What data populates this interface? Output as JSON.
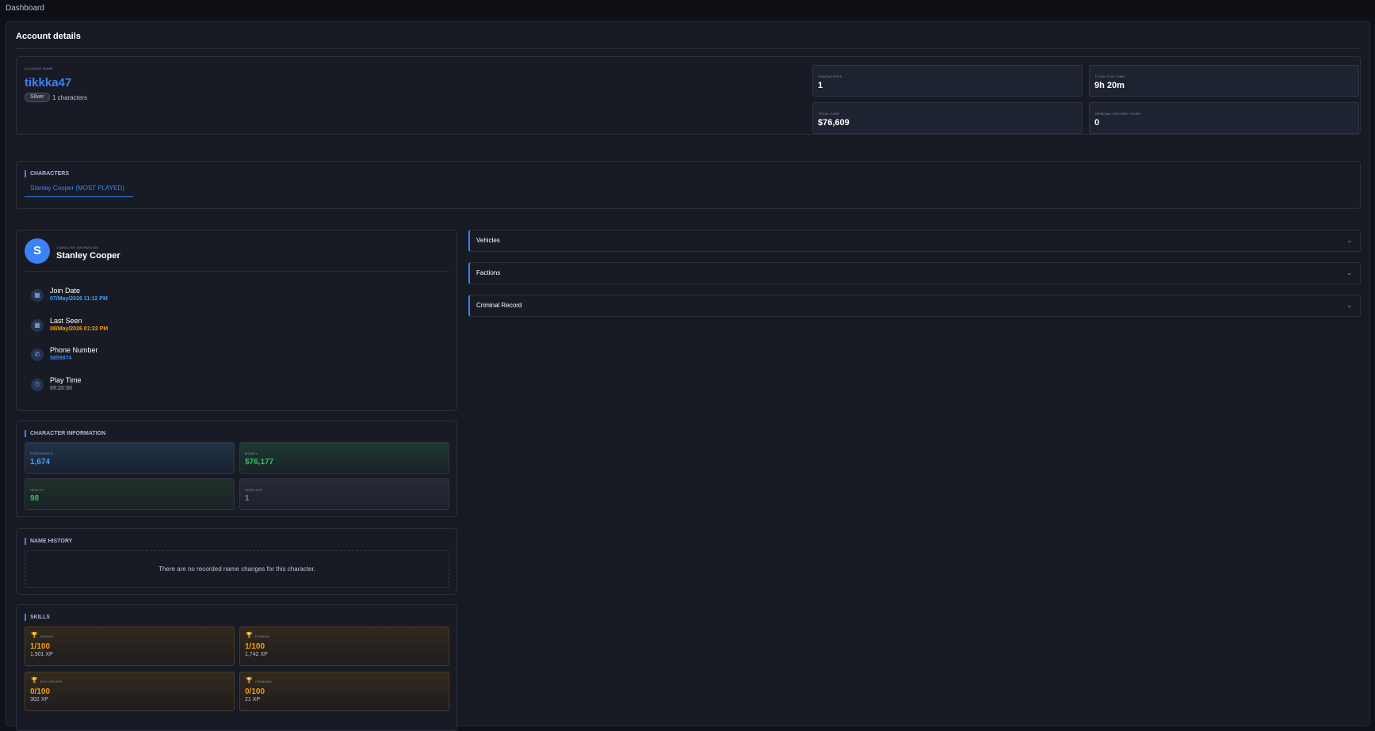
{
  "topbar": {
    "label": "Dashboard"
  },
  "panel": {
    "title": "Account details"
  },
  "account": {
    "name_label": "ACCOUNT NAME",
    "name": "tikkka47",
    "tier": "Silver",
    "characters_text": "1 characters",
    "stats": [
      {
        "label": "CHARACTERS",
        "value": "1"
      },
      {
        "label": "TOTAL PLAY TIME",
        "value": "9h 20m"
      },
      {
        "label": "TOTAL CASH",
        "value": "$76,609"
      },
      {
        "label": "CRIMINAL RECORD COUNT",
        "value": "0"
      }
    ]
  },
  "characters": {
    "heading": "CHARACTERS",
    "tabs": [
      {
        "label": "Stanley Cooper (MOST PLAYED)"
      }
    ]
  },
  "profile": {
    "avatar_letter": "S",
    "caption": "CHARACTER INFORMATION",
    "name": "Stanley Cooper",
    "rows": [
      {
        "icon": "calendar-icon",
        "label": "Join Date",
        "value": "07/May/2026 11:12 PM",
        "color": "#3ea0ff"
      },
      {
        "icon": "calendar-icon",
        "label": "Last Seen",
        "value": "08/May/2026 01:22 PM",
        "color": "#f59e0b"
      },
      {
        "icon": "phone-icon",
        "label": "Phone Number",
        "value": "5859874",
        "color": "#3b82f6"
      },
      {
        "icon": "stopwatch-icon",
        "label": "Play Time",
        "value": "09:20:50",
        "color": "#7a8296"
      }
    ]
  },
  "char_info": {
    "heading": "CHARACTER INFORMATION",
    "cards": [
      {
        "label": "EXPERIENCE",
        "value": "1,674",
        "color": "#3ea0ff",
        "bg": "#1c2b3f"
      },
      {
        "label": "MONEY",
        "value": "$76,177",
        "color": "#22c55e",
        "bg": "#1c2f29"
      },
      {
        "label": "HEALTH",
        "value": "98",
        "color": "#22c55e",
        "bg": "#1b2a25"
      },
      {
        "label": "VEHICLES",
        "value": "1",
        "color": "#7a8296",
        "bg": "#232834"
      }
    ]
  },
  "name_history": {
    "heading": "NAME HISTORY",
    "empty_text": "There are no recorded name changes for this character."
  },
  "skills": {
    "heading": "SKILLS",
    "items": [
      {
        "name": "MINING",
        "level": "1/100",
        "xp": "1,501 XP"
      },
      {
        "name": "FISHING",
        "level": "1/100",
        "xp": "1,742 XP"
      },
      {
        "name": "BUS DRIVER",
        "level": "0/100",
        "xp": "302 XP"
      },
      {
        "name": "CRIMINAL",
        "level": "0/100",
        "xp": "21 XP"
      }
    ]
  },
  "accordions": [
    {
      "title": "Vehicles",
      "icon": "chevron-down-icon"
    },
    {
      "title": "Factions",
      "icon": "chevron-down-icon"
    },
    {
      "title": "Criminal Record",
      "icon": "chevron-down-icon"
    }
  ]
}
